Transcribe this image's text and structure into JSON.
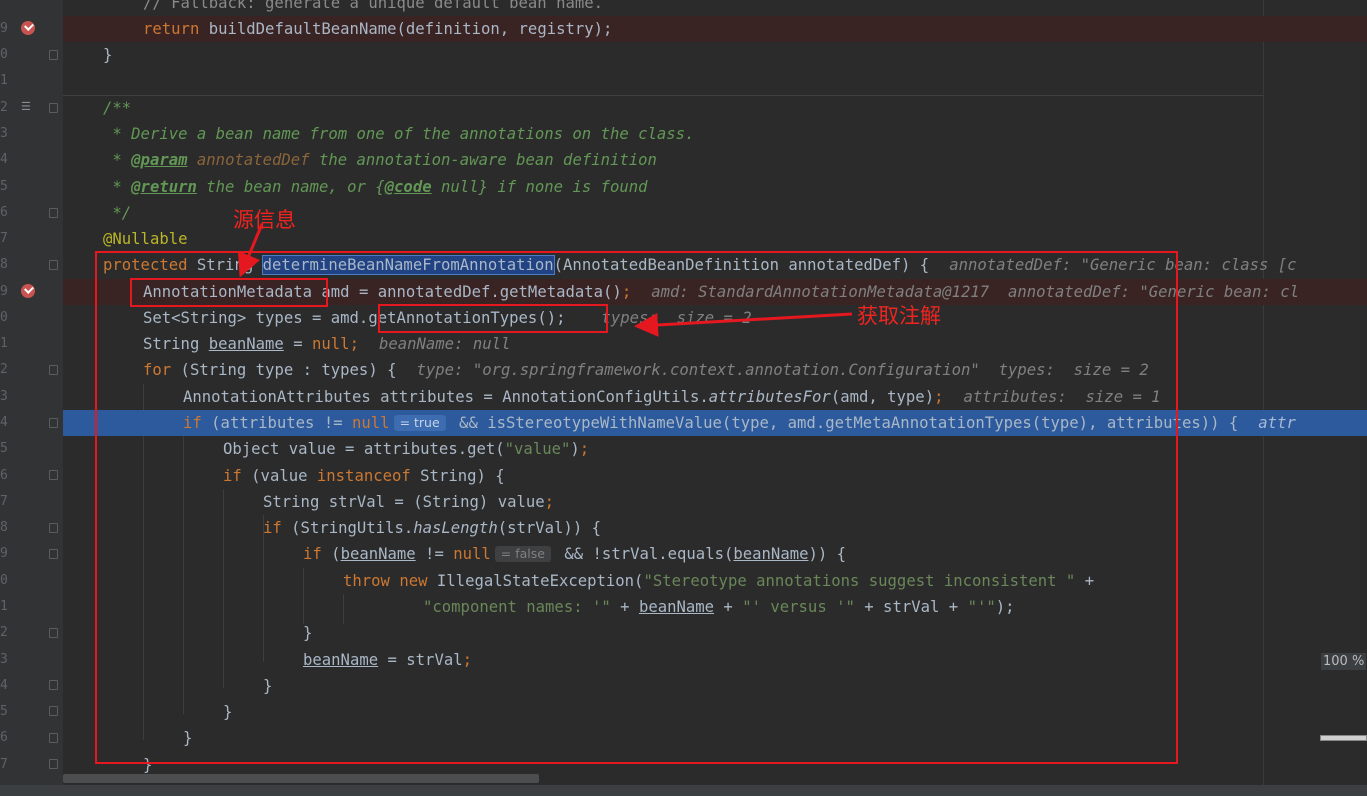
{
  "gutter": {
    "line_numbers": [
      "9",
      "0",
      "1",
      "2",
      "3",
      "4",
      "5",
      "6",
      "7",
      "8",
      "9",
      "0",
      "1",
      "2",
      "3",
      "4",
      "5",
      "6",
      "7",
      "8",
      "9",
      "0",
      "1",
      "2",
      "3",
      "4",
      "5",
      "6",
      "7"
    ]
  },
  "code": {
    "l0_comment": "// Fallback: generate a unique default bean name.",
    "l1_return": "return",
    "l1_call": " buildDefaultBeanName(definition, registry);",
    "l2_brace": "}",
    "l4_doc_open": "/**",
    "l5_doc": " * Derive a bean name from one of the annotations on the class.",
    "l6_star": " * ",
    "l6_tag": "@param",
    "l6_arg": " annotatedDef",
    "l6_rest": " the annotation-aware bean definition",
    "l7_star": " * ",
    "l7_tag": "@return",
    "l7_rest1": " the bean name, or {",
    "l7_code": "@code",
    "l7_rest2": " null} if none is found",
    "l8_close": " */",
    "l9_annotation": "@Nullable",
    "l10_kw": "protected",
    "l10_type": " String ",
    "l10_method": "determineBeanNameFromAnnotation",
    "l10_params": "(AnnotatedBeanDefinition annotatedDef) {",
    "l10_hint": "annotatedDef: \"Generic bean: class [c",
    "l11_type": "AnnotationMetadata",
    "l11_code": " amd = annotatedDef.getMetadata()",
    "l11_semi": ";",
    "l11_hint": "amd: StandardAnnotationMetadata@1217  annotatedDef: \"Generic bean: cl",
    "l12_code": "Set<String> types = amd.",
    "l12_call": "getAnnotationTypes();",
    "l12_hint": "types:  size = 2",
    "l13_code1": "String ",
    "l13_var": "beanName",
    "l13_code2": " = ",
    "l13_null": "null",
    "l13_semi": ";",
    "l13_hint": "beanName: null",
    "l14_kw": "for",
    "l14_code": " (String type : types) {",
    "l14_hint": "type: \"org.springframework.context.annotation.Configuration\"  types:  size = 2",
    "l15_code1": "AnnotationAttributes attributes = AnnotationConfigUtils.",
    "l15_method": "attributesFor",
    "l15_code2": "(amd, type)",
    "l15_semi": ";",
    "l15_hint": "attributes:  size = 1",
    "l16_kw": "if",
    "l16_code1": " (attributes != ",
    "l16_null": "null",
    "l16_inline": "= true",
    "l16_code2": " && isStereotypeWithNameValue(type, amd.getMetaAnnotationTypes(type), attributes)) {",
    "l16_hint": "attr",
    "l17_code1": "Object value = attributes.get(",
    "l17_str": "\"value\"",
    "l17_code2": ")",
    "l17_semi": ";",
    "l18_kw": "if",
    "l18_code1": " (value ",
    "l18_kw2": "instanceof",
    "l18_code2": " String) {",
    "l19_code1": "String strVal = (String) value",
    "l19_semi": ";",
    "l20_kw": "if",
    "l20_code1": " (StringUtils.",
    "l20_method": "hasLength",
    "l20_code2": "(strVal)) {",
    "l21_kw": "if",
    "l21_code1": " (",
    "l21_var": "beanName",
    "l21_code2": " != ",
    "l21_null": "null",
    "l21_inline": "= false",
    "l21_code3": " && !strVal.equals(",
    "l21_var2": "beanName",
    "l21_code4": ")) {",
    "l22_kw": "throw",
    "l22_kw2": " new",
    "l22_code1": " IllegalStateException(",
    "l22_str": "\"Stereotype annotations suggest inconsistent \"",
    "l22_code2": " +",
    "l23_str1": "\"component names: '\"",
    "l23_code1": " + ",
    "l23_var": "beanName",
    "l23_code2": " + ",
    "l23_str2": "\"' versus '\"",
    "l23_code3": " + strVal + ",
    "l23_str3": "\"'\"",
    "l23_code4": ");",
    "l24_brace": "}",
    "l25_var": "beanName",
    "l25_code": " = strVal",
    "l25_semi": ";",
    "l26_brace": "}",
    "l27_brace": "}",
    "l28_brace": "}",
    "l29_brace": "}"
  },
  "annotations": {
    "source_info_label": "源信息",
    "get_annotation_label": "获取注解"
  },
  "zoom_level": "100 %",
  "colors": {
    "background": "#2b2b2b",
    "gutter": "#313335",
    "keyword": "#cc7832",
    "string": "#6a8759",
    "doc_comment": "#629755",
    "annotation": "#bbb529",
    "execution_line": "#2d5a9c",
    "markup_red": "#e5171f"
  }
}
